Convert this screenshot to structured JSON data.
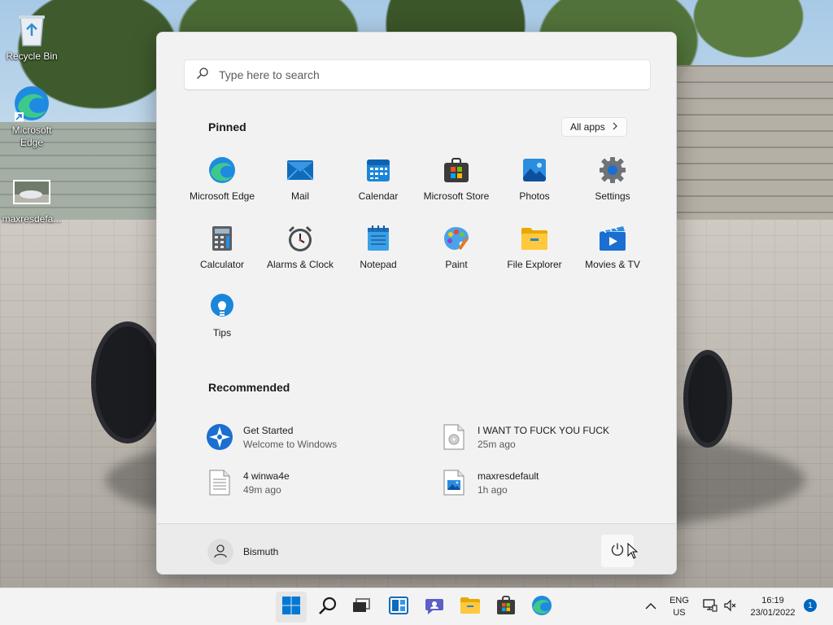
{
  "desktop": {
    "icons": [
      {
        "label": "Recycle Bin",
        "icon": "recycle-bin-icon"
      },
      {
        "label": "Microsoft Edge",
        "icon": "edge-icon"
      },
      {
        "label": "maxresdefa...",
        "icon": "image-thumbnail-icon"
      }
    ]
  },
  "start_menu": {
    "search": {
      "placeholder": "Type here to search"
    },
    "pinned_title": "Pinned",
    "all_apps_label": "All apps",
    "pinned": [
      {
        "label": "Microsoft Edge",
        "icon": "edge-icon"
      },
      {
        "label": "Mail",
        "icon": "mail-icon"
      },
      {
        "label": "Calendar",
        "icon": "calendar-icon"
      },
      {
        "label": "Microsoft Store",
        "icon": "store-icon"
      },
      {
        "label": "Photos",
        "icon": "photos-icon"
      },
      {
        "label": "Settings",
        "icon": "gear-icon"
      },
      {
        "label": "Calculator",
        "icon": "calculator-icon"
      },
      {
        "label": "Alarms & Clock",
        "icon": "clock-icon"
      },
      {
        "label": "Notepad",
        "icon": "notepad-icon"
      },
      {
        "label": "Paint",
        "icon": "paint-icon"
      },
      {
        "label": "File Explorer",
        "icon": "folder-icon"
      },
      {
        "label": "Movies & TV",
        "icon": "movies-icon"
      },
      {
        "label": "Tips",
        "icon": "lightbulb-icon"
      }
    ],
    "recommended_title": "Recommended",
    "recommended": [
      {
        "name": "Get Started",
        "sub": "Welcome to Windows",
        "icon": "get-started-icon"
      },
      {
        "name": "I WANT TO FUCK YOU FUCK",
        "sub": "25m ago",
        "icon": "audio-file-icon"
      },
      {
        "name": "4 winwa4e",
        "sub": "49m ago",
        "icon": "text-file-icon"
      },
      {
        "name": "maxresdefault",
        "sub": "1h ago",
        "icon": "image-file-icon"
      }
    ],
    "user": {
      "name": "Bismuth"
    },
    "power_icon": "power-icon"
  },
  "taskbar": {
    "apps": [
      "start-icon",
      "search-icon",
      "task-view-icon",
      "widgets-icon",
      "chat-icon",
      "folder-icon",
      "store-icon",
      "edge-icon"
    ],
    "tray": {
      "lang_top": "ENG",
      "lang_bottom": "US",
      "time": "16:19",
      "date": "23/01/2022",
      "notifications": "1"
    }
  },
  "colors": {
    "accent": "#0067c0",
    "menu_bg": "#f2f2f2",
    "taskbar_bg": "#f3f3f3"
  }
}
